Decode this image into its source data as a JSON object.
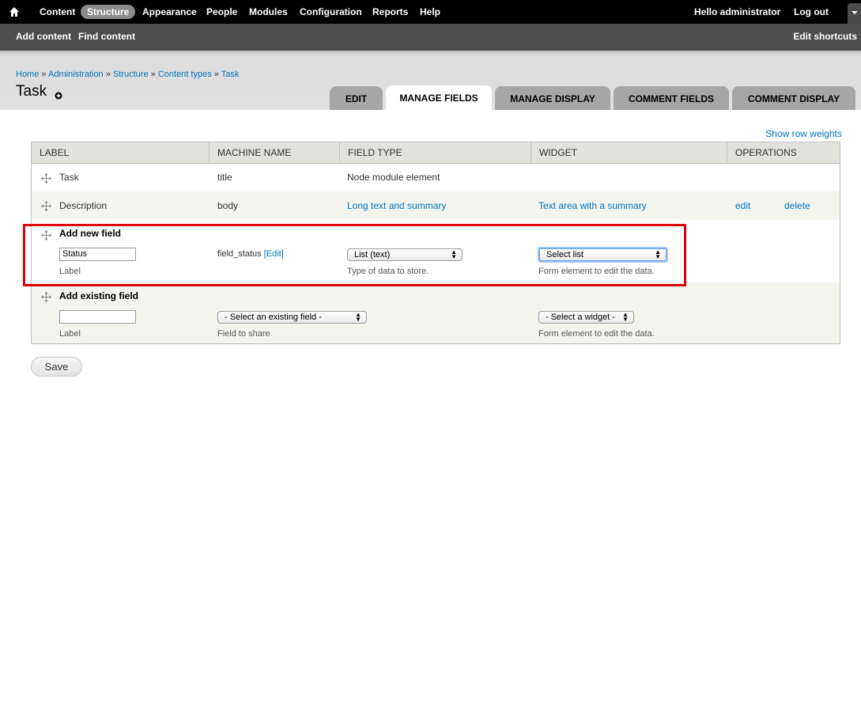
{
  "toolbar": {
    "home_icon": "home-icon",
    "menu": [
      "Content",
      "Structure",
      "Appearance",
      "People",
      "Modules",
      "Configuration",
      "Reports",
      "Help"
    ],
    "active_item": "Structure",
    "greeting_prefix": "Hello ",
    "username": "administrator",
    "logout": "Log out"
  },
  "shortcuts": {
    "items": [
      "Add content",
      "Find content"
    ],
    "edit_shortcuts": "Edit shortcuts"
  },
  "breadcrumb": {
    "items": [
      "Home",
      "Administration",
      "Structure",
      "Content types",
      "Task"
    ],
    "separator": "»"
  },
  "page_title": "Task",
  "tabs": [
    "EDIT",
    "MANAGE FIELDS",
    "MANAGE DISPLAY",
    "COMMENT FIELDS",
    "COMMENT DISPLAY"
  ],
  "active_tab": "MANAGE FIELDS",
  "show_row_weights": "Show row weights",
  "table": {
    "headers": [
      "LABEL",
      "MACHINE NAME",
      "FIELD TYPE",
      "WIDGET",
      "OPERATIONS"
    ],
    "rows": [
      {
        "label": "Task",
        "machine_name": "title",
        "field_type": "Node module element",
        "widget": "",
        "edit": "",
        "delete": ""
      },
      {
        "label": "Description",
        "machine_name": "body",
        "field_type": "Long text and summary",
        "widget": "Text area with a summary",
        "edit": "edit",
        "delete": "delete"
      }
    ],
    "add_new": {
      "title": "Add new field",
      "label_value": "Status",
      "label_desc": "Label",
      "machine_name": "field_status",
      "machine_edit": "[Edit]",
      "type_value": "List (text)",
      "type_desc": "Type of data to store.",
      "widget_value": "Select list",
      "widget_desc": "Form element to edit the data."
    },
    "add_existing": {
      "title": "Add existing field",
      "label_value": "",
      "label_desc": "Label",
      "field_value": "- Select an existing field -",
      "field_desc": "Field to share",
      "widget_value": "- Select a widget -",
      "widget_desc": "Form element to edit the data."
    }
  },
  "save_label": "Save",
  "colors": {
    "toolbar_bg": "#000000",
    "shortcuts_bg": "#4d4d4d",
    "link": "#0074bd",
    "highlight": "#e0000a"
  }
}
